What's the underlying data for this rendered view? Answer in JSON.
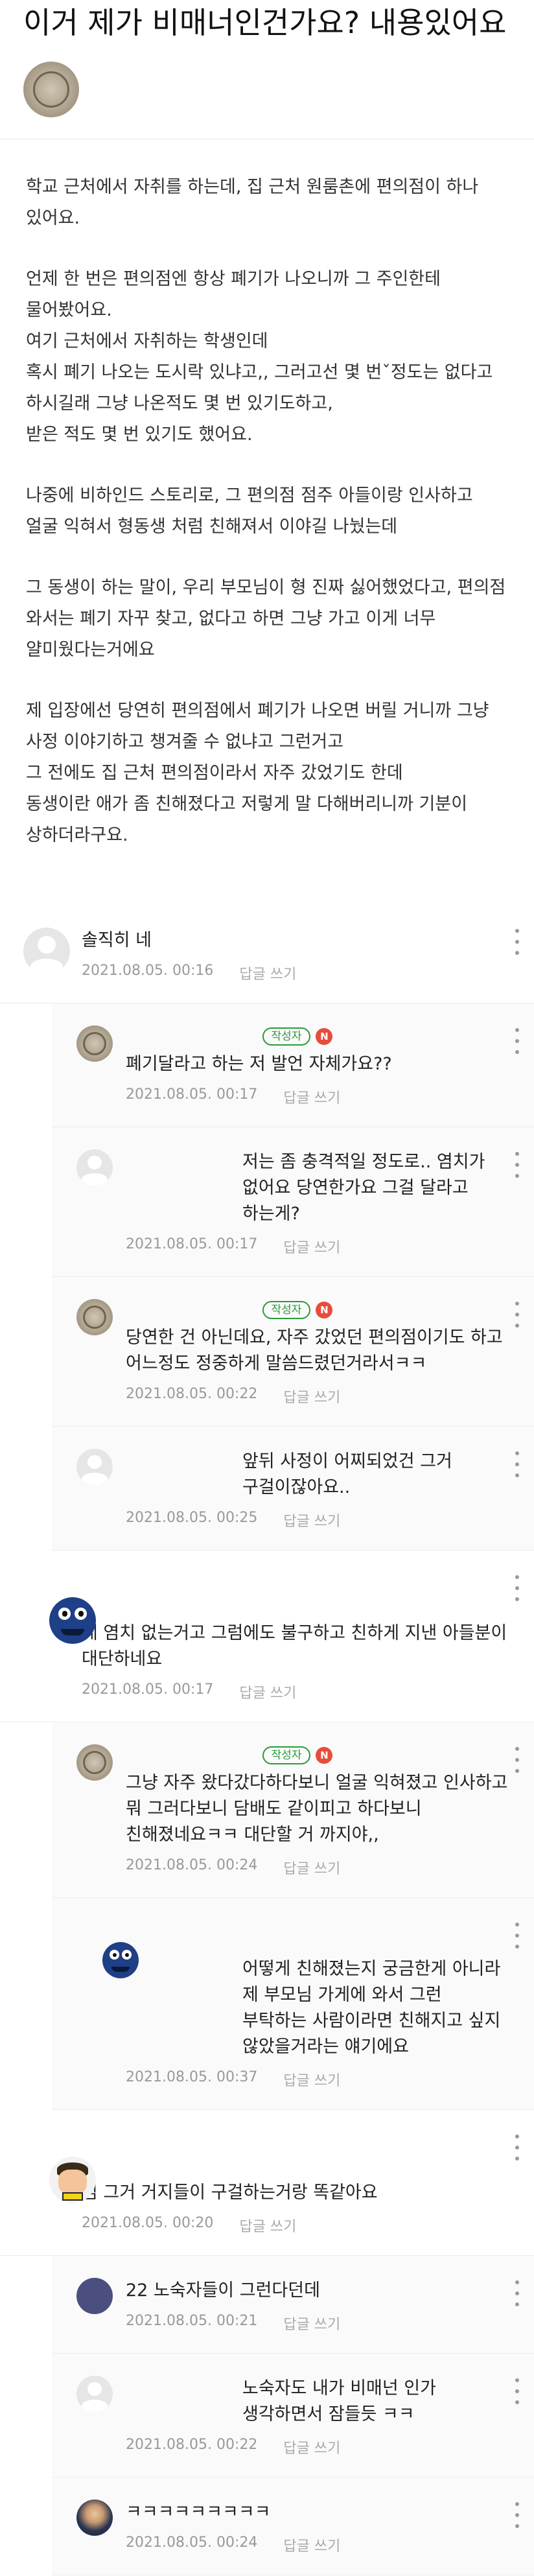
{
  "post": {
    "title": "이거 제가 비매너인건가요? 내용있어요",
    "paragraphs": [
      "학교 근처에서 자취를 하는데, 집 근처 원룸촌에 편의점이 하나 있어요.",
      "언제 한 번은  편의점엔 항상 폐기가 나오니까 그 주인한테 물어봤어요.\n여기 근처에서 자취하는 학생인데\n혹시 폐기 나오는 도시락 있냐고,, 그러고선 몇 번ˇ정도는 없다고 하시길래 그냥 나온적도 몇 번 있기도하고,\n받은 적도 몇 번 있기도 했어요.",
      "나중에 비하인드 스토리로, 그 편의점 점주 아들이랑 인사하고 얼굴 익혀서 형동생 처럼 친해져서 이야길 나눴는데",
      "그 동생이 하는 말이, 우리 부모님이 형 진짜 싫어했었다고, 편의점 와서는 폐기 자꾸 찾고, 없다고 하면 그냥 가고 이게 너무 얄미웠다는거에요",
      "제 입장에선 당연히 편의점에서 폐기가 나오면 버릴 거니까 그냥 사정 이야기하고 챙겨줄 수 없냐고 그런거고\n그 전에도 집 근처 편의점이라서 자주 갔었기도 한데\n동생이란 애가 좀 친해졌다고 저렇게 말 다해버리니까 기분이 상하더라구요."
    ]
  },
  "comment_labels": {
    "reply": "답글 쓰기",
    "author_badge": "작성자",
    "new_badge": "N"
  },
  "comments": [
    {
      "type": "top",
      "avatar": "default",
      "text": "솔직히 네",
      "date": "2021.08.05. 00:16"
    },
    {
      "type": "reply",
      "avatar": "seal",
      "is_author": true,
      "text": "폐기달라고 하는 저 발언 자체가요??",
      "date": "2021.08.05. 00:17"
    },
    {
      "type": "reply",
      "avatar": "default",
      "text": "저는 좀 충격적일 정도로.. 염치가 없어요 당연한가요 그걸 달라고 하는게?",
      "date": "2021.08.05. 00:17"
    },
    {
      "type": "reply",
      "avatar": "seal",
      "is_author": true,
      "text": "당연한 건 아닌데요, 자주 갔었던 편의점이기도 하고 어느정도 정중하게 말씀드렸던거라서ㅋㅋ",
      "date": "2021.08.05. 00:22"
    },
    {
      "type": "reply",
      "avatar": "default",
      "text": "앞뒤 사정이 어찌되었건 그거 구걸이잖아요..",
      "date": "2021.08.05. 00:25"
    },
    {
      "type": "top",
      "avatar": "monster",
      "text": "네 염치 없는거고 그럼에도 불구하고 친하게 지낸 아들분이 대단하네요",
      "date": "2021.08.05. 00:17"
    },
    {
      "type": "reply",
      "avatar": "seal",
      "is_author": true,
      "text": "그냥 자주 왔다갔다하다보니 얼굴 익혀졌고 인사하고 뭐 그러다보니 담배도 같이피고 하다보니 친해졌네요ㅋㅋ 대단할 거 까지야,,",
      "date": "2021.08.05. 00:24"
    },
    {
      "type": "reply",
      "avatar": "monster",
      "text": "어떻게 친해졌는지 궁금한게 아니라 제 부모님 가게에 와서 그런 부탁하는 사람이라면 친해지고 싶지 않았을거라는 얘기에요",
      "date": "2021.08.05. 00:37"
    },
    {
      "type": "top",
      "avatar": "character",
      "text": "님 그거 거지들이 구걸하는거랑 똑같아요",
      "date": "2021.08.05. 00:20"
    },
    {
      "type": "reply",
      "avatar": "dark",
      "text": "22 노숙자들이 그런다던데",
      "date": "2021.08.05. 00:21"
    },
    {
      "type": "reply",
      "avatar": "default",
      "text": "노숙자도 내가 비매넌 인가 생각하면서 잠들듯 ㅋㅋ",
      "date": "2021.08.05. 00:22"
    },
    {
      "type": "reply",
      "avatar": "photo",
      "text": "ㅋㅋㅋㅋㅋㅋㅋㅋㅋ",
      "date": "2021.08.05. 00:24"
    }
  ]
}
